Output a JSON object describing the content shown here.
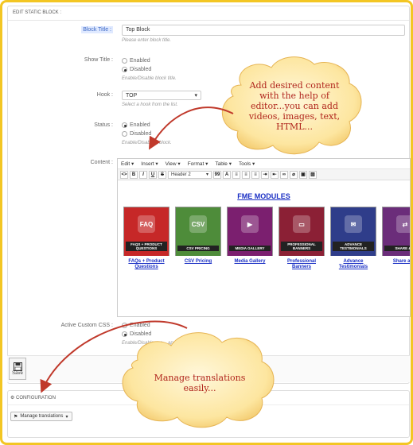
{
  "panel": {
    "title": "EDIT STATIC BLOCK :"
  },
  "block_title": {
    "label": "Block Title :",
    "value": "Top Block",
    "help": "Please enter block title."
  },
  "show_title": {
    "label": "Show Title :",
    "opt_enabled": "Enabled",
    "opt_disabled": "Disabled",
    "selected": "Disabled",
    "help": "Enable/Disable block title."
  },
  "hook": {
    "label": "Hook :",
    "value": "TOP",
    "help": "Select a hook from the list."
  },
  "status": {
    "label": "Status :",
    "opt_enabled": "Enabled",
    "opt_disabled": "Disabled",
    "selected": "Enabled",
    "help": "Enable/Disable a block."
  },
  "content": {
    "label": "Content :",
    "menu": [
      "Edit",
      "Insert",
      "View",
      "Format",
      "Table",
      "Tools"
    ],
    "toolbar": {
      "code": "<>",
      "bold": "B",
      "italic": "I",
      "underline": "U",
      "strike": "S",
      "heading": "Header 2",
      "quote": "99",
      "font": "A"
    },
    "heading": "FME MODULES",
    "tiles": [
      {
        "name": "FAQs + Product Questions",
        "icon": "FAQ",
        "color": "#c62828",
        "caption": "FAQs + Product Questions"
      },
      {
        "name": "CSV Pricing",
        "icon": "CSV",
        "color": "#4e8c3a",
        "caption": "CSV Pricing"
      },
      {
        "name": "Media Gallery",
        "icon": "▶",
        "color": "#7b1f6f",
        "caption": "Media Gallery"
      },
      {
        "name": "Professional Banners",
        "icon": "▭",
        "color": "#8b2035",
        "caption": "Professional Banners"
      },
      {
        "name": "Advance Testimonials",
        "icon": "✉",
        "color": "#2f3d8a",
        "caption": "Advance Testimonials"
      },
      {
        "name": "Share & ...",
        "icon": "⇄",
        "color": "#6b2d7a",
        "caption": "Share an..."
      }
    ]
  },
  "custom_css": {
    "label": "Active Custom CSS :",
    "opt_enabled": "Enabled",
    "opt_disabled": "Disabled",
    "selected": "Disabled",
    "help": "Enable/Disable cus... apply)."
  },
  "save": {
    "label": "Save"
  },
  "configuration": {
    "title": "CONFIGURATION",
    "button": "Manage translations"
  },
  "callouts": {
    "top": "Add desired content with the help of editor...you can add videos, images, text, HTML...",
    "bottom": "Manage translations easily..."
  },
  "colors": {
    "frame": "#f3c623",
    "cloud_fill": "#fdebb0",
    "cloud_text": "#b0241c",
    "link": "#1a2fc4"
  }
}
